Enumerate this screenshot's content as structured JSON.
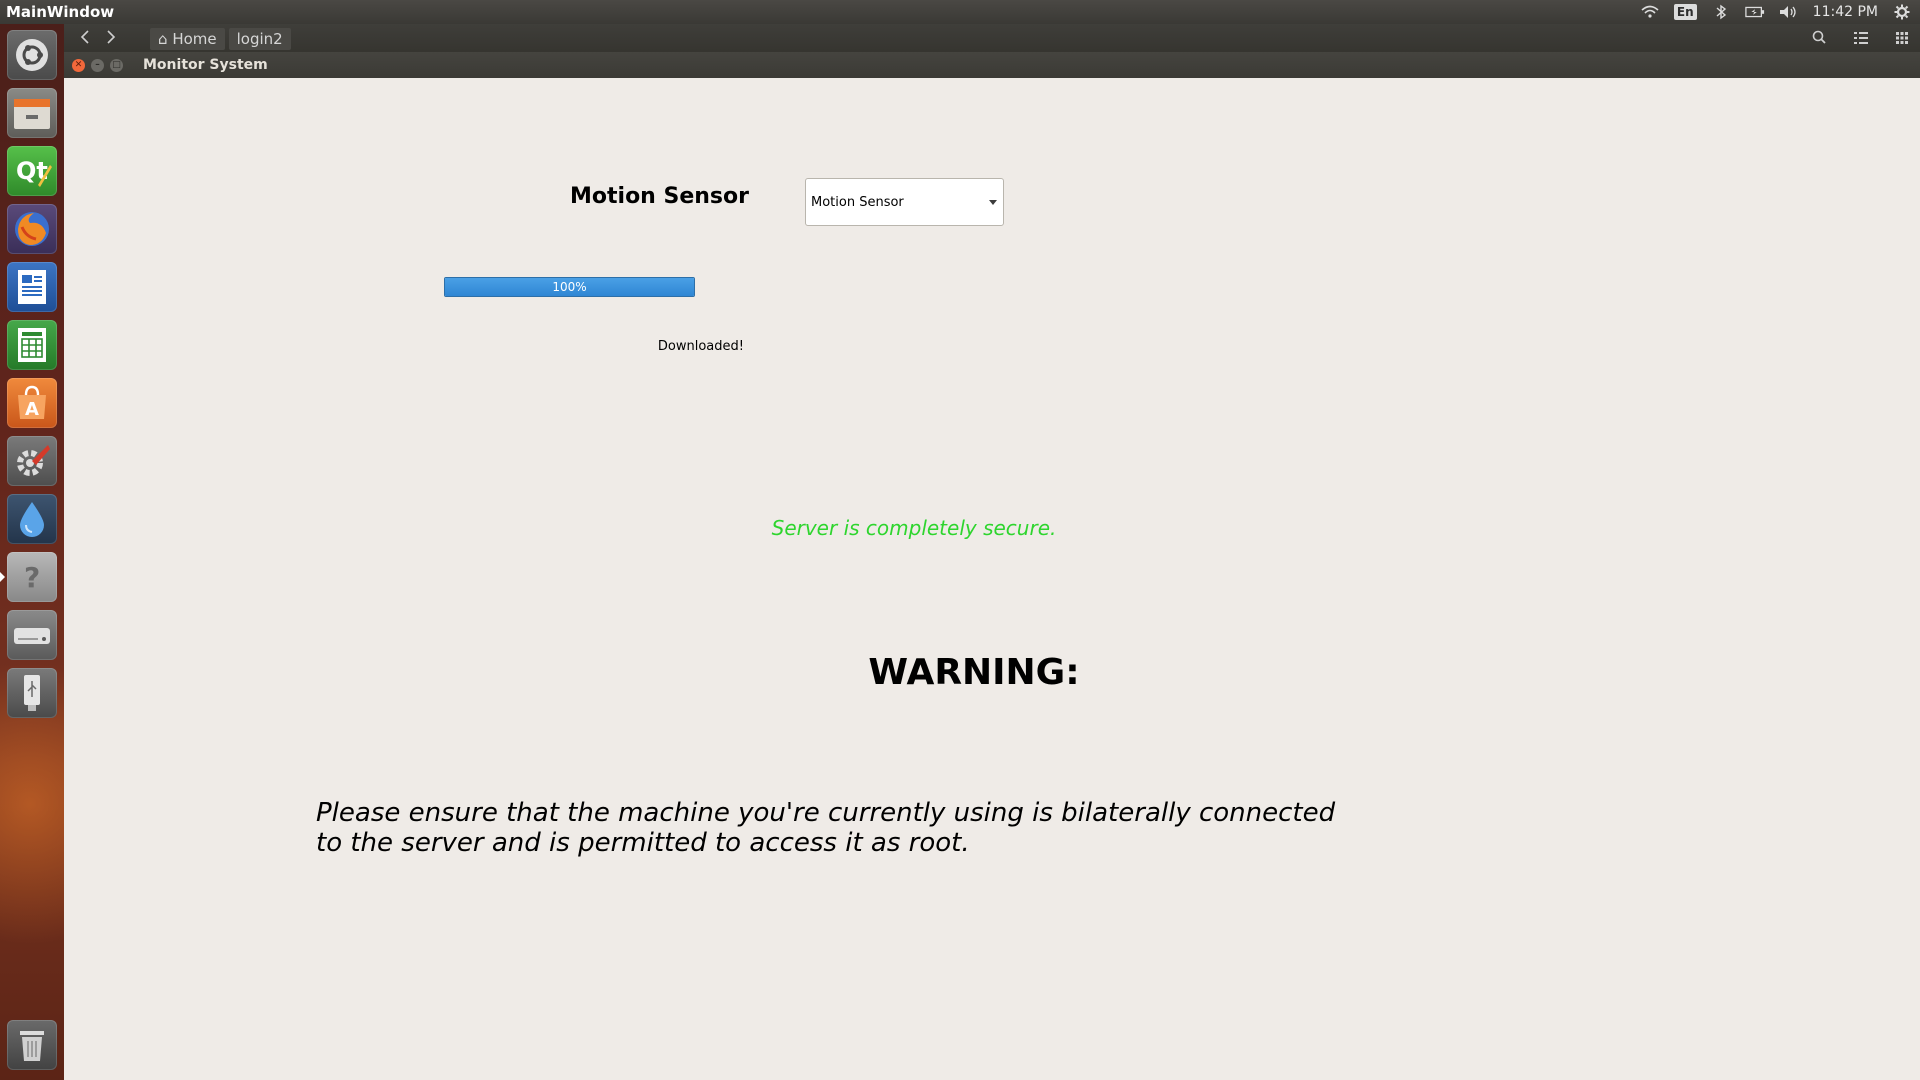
{
  "top_panel": {
    "title": "MainWindow",
    "language": "En",
    "clock": "11:42 PM",
    "icons": [
      "wifi-icon",
      "bluetooth-icon",
      "battery-icon",
      "volume-icon",
      "settings-gear-icon"
    ]
  },
  "launcher": {
    "items": [
      {
        "name": "ubuntu-dash-icon"
      },
      {
        "name": "files-icon"
      },
      {
        "name": "qt-creator-icon"
      },
      {
        "name": "firefox-icon"
      },
      {
        "name": "writer-icon"
      },
      {
        "name": "calc-icon"
      },
      {
        "name": "software-center-icon"
      },
      {
        "name": "system-settings-icon"
      },
      {
        "name": "water-drop-icon"
      },
      {
        "name": "help-icon"
      },
      {
        "name": "disk-drive-icon"
      },
      {
        "name": "usb-drive-icon"
      },
      {
        "name": "trash-icon"
      }
    ]
  },
  "file_header": {
    "crumbs": [
      "Home",
      "login2"
    ]
  },
  "window": {
    "title": "Monitor System"
  },
  "main": {
    "sensor_heading": "Motion Sensor",
    "sensor_select": {
      "selected": "Motion Sensor"
    },
    "progress": {
      "value": 100,
      "label": "100%"
    },
    "download_status": "Downloaded!",
    "secure_message": "Server is completely secure.",
    "warning_title": "WARNING:",
    "warning_body_line1": "Please ensure that the machine you're currently using is bilaterally connected",
    "warning_body_line2": "to the server and is permitted to access it as root."
  },
  "colors": {
    "secure_text": "#2ed52e",
    "progress_fill": "#2f86d4",
    "window_bg": "#efebe7",
    "close_button": "#f2683b"
  }
}
